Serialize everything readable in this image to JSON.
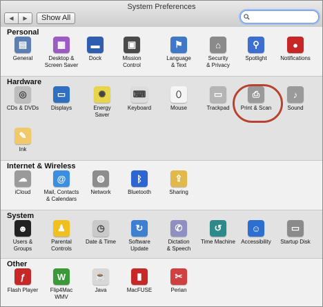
{
  "window": {
    "title": "System Preferences"
  },
  "toolbar": {
    "back": "◀",
    "forward": "▶",
    "show_all": "Show All"
  },
  "search": {
    "value": "",
    "placeholder": ""
  },
  "sections": {
    "personal": {
      "title": "Personal",
      "items": [
        {
          "label": "General",
          "icon": "general-icon",
          "color": "#5b7fb3"
        },
        {
          "label": "Desktop &\nScreen Saver",
          "icon": "desktop-icon",
          "color": "#9b5bc4"
        },
        {
          "label": "Dock",
          "icon": "dock-icon",
          "color": "#2f5db0"
        },
        {
          "label": "Mission\nControl",
          "icon": "mission-control-icon",
          "color": "#4a4a4a"
        },
        {
          "label": "Language\n& Text",
          "icon": "language-icon",
          "color": "#3f78c9"
        },
        {
          "label": "Security\n& Privacy",
          "icon": "security-icon",
          "color": "#8a8a8a"
        },
        {
          "label": "Spotlight",
          "icon": "spotlight-icon",
          "color": "#3d6fd1"
        },
        {
          "label": "Notifications",
          "icon": "notifications-icon",
          "color": "#c62828"
        }
      ]
    },
    "hardware": {
      "title": "Hardware",
      "items": [
        {
          "label": "CDs & DVDs",
          "icon": "cd-icon",
          "color": "#bdbdbd"
        },
        {
          "label": "Displays",
          "icon": "displays-icon",
          "color": "#2f6fc0"
        },
        {
          "label": "Energy\nSaver",
          "icon": "energy-saver-icon",
          "color": "#e8d54a"
        },
        {
          "label": "Keyboard",
          "icon": "keyboard-icon",
          "color": "#dcdcdc"
        },
        {
          "label": "Mouse",
          "icon": "mouse-icon",
          "color": "#f5f5f5"
        },
        {
          "label": "Trackpad",
          "icon": "trackpad-icon",
          "color": "#b5b5b5"
        },
        {
          "label": "Print & Scan",
          "icon": "print-scan-icon",
          "color": "#9a9a9a"
        },
        {
          "label": "Sound",
          "icon": "sound-icon",
          "color": "#9a9a9a"
        },
        {
          "label": "Ink",
          "icon": "ink-icon",
          "color": "#f1c96a"
        }
      ]
    },
    "internet": {
      "title": "Internet & Wireless",
      "items": [
        {
          "label": "iCloud",
          "icon": "icloud-icon",
          "color": "#9a9a9a"
        },
        {
          "label": "Mail, Contacts\n& Calendars",
          "icon": "mail-contacts-icon",
          "color": "#3b8fe0"
        },
        {
          "label": "Network",
          "icon": "network-icon",
          "color": "#8d8d8d"
        },
        {
          "label": "Bluetooth",
          "icon": "bluetooth-icon",
          "color": "#2d66d0"
        },
        {
          "label": "Sharing",
          "icon": "sharing-icon",
          "color": "#e0b84c"
        }
      ]
    },
    "system": {
      "title": "System",
      "items": [
        {
          "label": "Users &\nGroups",
          "icon": "users-groups-icon",
          "color": "#222222"
        },
        {
          "label": "Parental\nControls",
          "icon": "parental-controls-icon",
          "color": "#f0c020"
        },
        {
          "label": "Date & Time",
          "icon": "date-time-icon",
          "color": "#c9c9c9"
        },
        {
          "label": "Software\nUpdate",
          "icon": "software-update-icon",
          "color": "#3d7fd0"
        },
        {
          "label": "Dictation\n& Speech",
          "icon": "dictation-icon",
          "color": "#8f8fc2"
        },
        {
          "label": "Time Machine",
          "icon": "time-machine-icon",
          "color": "#2d8a8a"
        },
        {
          "label": "Accessibility",
          "icon": "accessibility-icon",
          "color": "#2d6fd1"
        },
        {
          "label": "Startup Disk",
          "icon": "startup-disk-icon",
          "color": "#8a8a8a"
        }
      ]
    },
    "other": {
      "title": "Other",
      "items": [
        {
          "label": "Flash Player",
          "icon": "flash-player-icon",
          "color": "#c62828"
        },
        {
          "label": "Flip4Mac\nWMV",
          "icon": "flip4mac-icon",
          "color": "#3a9a3a"
        },
        {
          "label": "Java",
          "icon": "java-icon",
          "color": "#d8d8d8"
        },
        {
          "label": "MacFUSE",
          "icon": "macfuse-icon",
          "color": "#c62828"
        },
        {
          "label": "Perian",
          "icon": "perian-icon",
          "color": "#d04040"
        }
      ]
    }
  }
}
